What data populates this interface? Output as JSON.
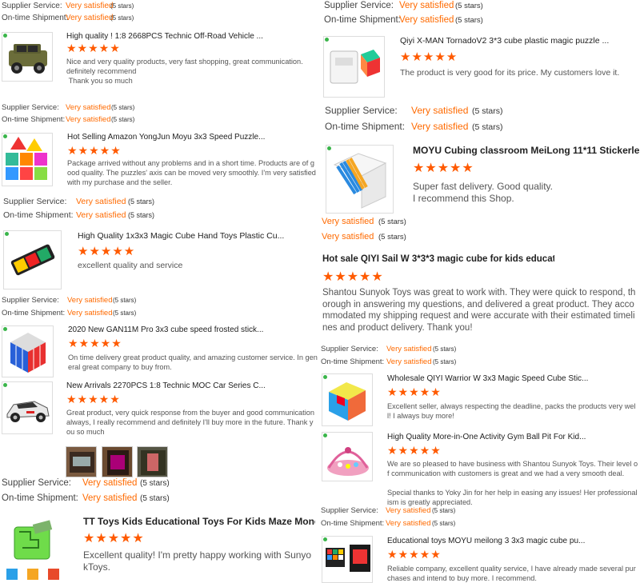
{
  "labels": {
    "supplier_service": "Supplier Service:",
    "ontime_shipment": "On-time Shipment:",
    "very_satisfied": "Very satisfied",
    "five_stars": "(5 stars)",
    "stars_glyph": "★★★★★"
  },
  "left": {
    "top_rating": {
      "supplier": "Very satisfied",
      "ontime": "Very satisfied"
    },
    "items": [
      {
        "title": "High quality ! 1:8 2668PCS Technic Off-Road Vehicle ...",
        "review": "Nice and very quality products, very fast shopping, great communication.  definitely recommend\n Thank you so much",
        "image_icon": "off-road-vehicle-image"
      },
      {
        "title": "Hot Selling Amazon YongJun Moyu 3x3 Speed Puzzle...",
        "review": "Package arrived without any problems and in a short time. Products are of good quality. The puzzles' axis can be moved very smoothly. I'm very satisfied with my purchase and the seller.",
        "image_icon": "puzzle-cubes-image"
      },
      {
        "title": "High Quality 1x3x3 Magic Cube Hand Toys Plastic Cu...",
        "review": "excellent quality and service",
        "image_icon": "spinner-cube-image"
      },
      {
        "title": "2020 New GAN11M Pro 3x3 cube speed frosted stick...",
        "review": "On time delivery great product quality, and amazing customer service. In general great company to buy from.",
        "image_icon": "gan-cube-image"
      },
      {
        "title": "New Arrivals 2270PCS 1:8 Technic MOC Car Series C...",
        "review": "Great product, very quick response from the buyer and good communication always, I really recommend and definitely I'll buy more in the future. Thank you so much",
        "image_icon": "technic-car-image"
      },
      {
        "title": "TT Toys Kids Educational Toys For Kids Maze Money ...",
        "review": "Excellent quality! I'm pretty happy working with SunyokToys.",
        "image_icon": "maze-money-box-image"
      }
    ]
  },
  "right": {
    "items": [
      {
        "title": "Qiyi X-MAN TornadoV2 3*3 cube plastic magic puzzle ...",
        "review": "The product is very good for its price. My customers love it.",
        "image_icon": "tornado-cube-image"
      },
      {
        "title": "MOYU Cubing classroom MeiLong 11*11 Stickerless ...",
        "review": "Super fast delivery. Good quality.\nI recommend this Shop.",
        "image_icon": "meilong-cube-image"
      },
      {
        "title": "Hot sale QIYI Sail W 3*3*3 magic cube for kids educat...",
        "review": "Shantou Sunyok Toys was great to work with. They were quick to respond, thorough in answering my questions, and delivered a great product. They accommodated my shipping request and were accurate with their estimated timelines and product delivery. Thank you!",
        "image_icon": ""
      },
      {
        "title": "Wholesale QIYI Warrior W 3x3 Magic Speed Cube Stic...",
        "review": "Excellent seller, always respecting the deadline, packs the products very well! I always buy more!",
        "image_icon": "warrior-cube-image"
      },
      {
        "title": "High Quality More-in-One Activity Gym Ball Pit For Kid...",
        "review": "We are so pleased to have business with Shantou Sunyok Toys. Their level of communication with customers is great and we had a very smooth deal.\n\nSpecial thanks to Yoky Jin for her help in easing any issues! Her professionalism is greatly appreciated.",
        "image_icon": "activity-gym-image"
      },
      {
        "title": "Educational toys MOYU meilong 3 3x3 magic cube pu...",
        "review": "Reliable company, excellent quality service, I have already made several purchases and intend to buy more. I recommend.",
        "image_icon": "meilong-3-cube-image"
      }
    ]
  },
  "colors": {
    "accent": "#ff6a00",
    "star": "#ff5a00",
    "badge": "#3ab54a"
  }
}
